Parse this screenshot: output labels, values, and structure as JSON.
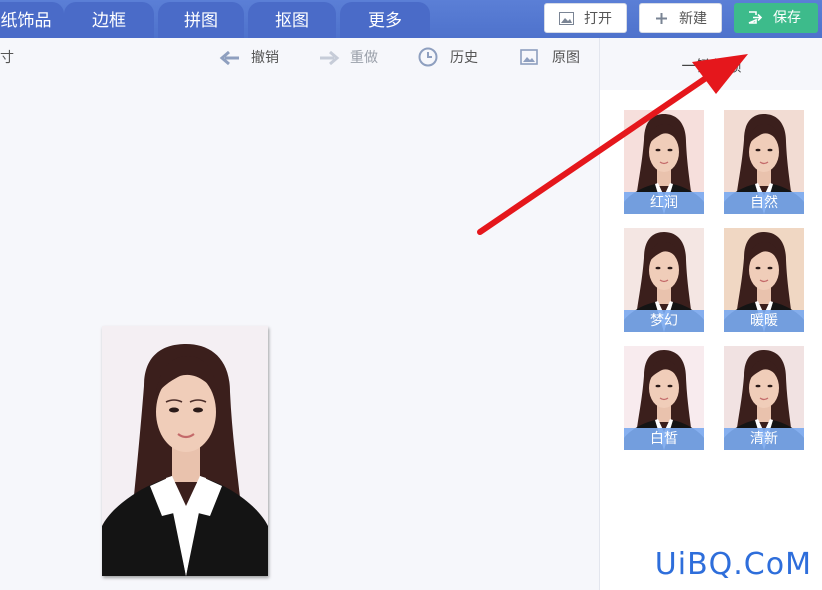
{
  "tabs": [
    {
      "label": "纸饰品"
    },
    {
      "label": "边框"
    },
    {
      "label": "拼图"
    },
    {
      "label": "抠图"
    },
    {
      "label": "更多"
    }
  ],
  "actions": {
    "open": "打开",
    "new": "新建",
    "save": "保存"
  },
  "toolbar": {
    "size_label": "寸",
    "undo": "撤销",
    "redo": "重做",
    "history": "历史",
    "original": "原图"
  },
  "panel": {
    "title": "一键美颜",
    "presets": [
      {
        "label": "红润",
        "tone": "#f6dfdc"
      },
      {
        "label": "自然",
        "tone": "#f2dcd3"
      },
      {
        "label": "梦幻",
        "tone": "#f4e6e3"
      },
      {
        "label": "暖暖",
        "tone": "#f0d7c3"
      },
      {
        "label": "白皙",
        "tone": "#f8ebee"
      },
      {
        "label": "清新",
        "tone": "#f1e2e2"
      }
    ]
  },
  "watermark": "UiBQ.CoM",
  "colors": {
    "topbar": "#4e72cc",
    "save": "#3dbb8b",
    "caption": "#7caaf0",
    "arrow": "#e5171c"
  }
}
